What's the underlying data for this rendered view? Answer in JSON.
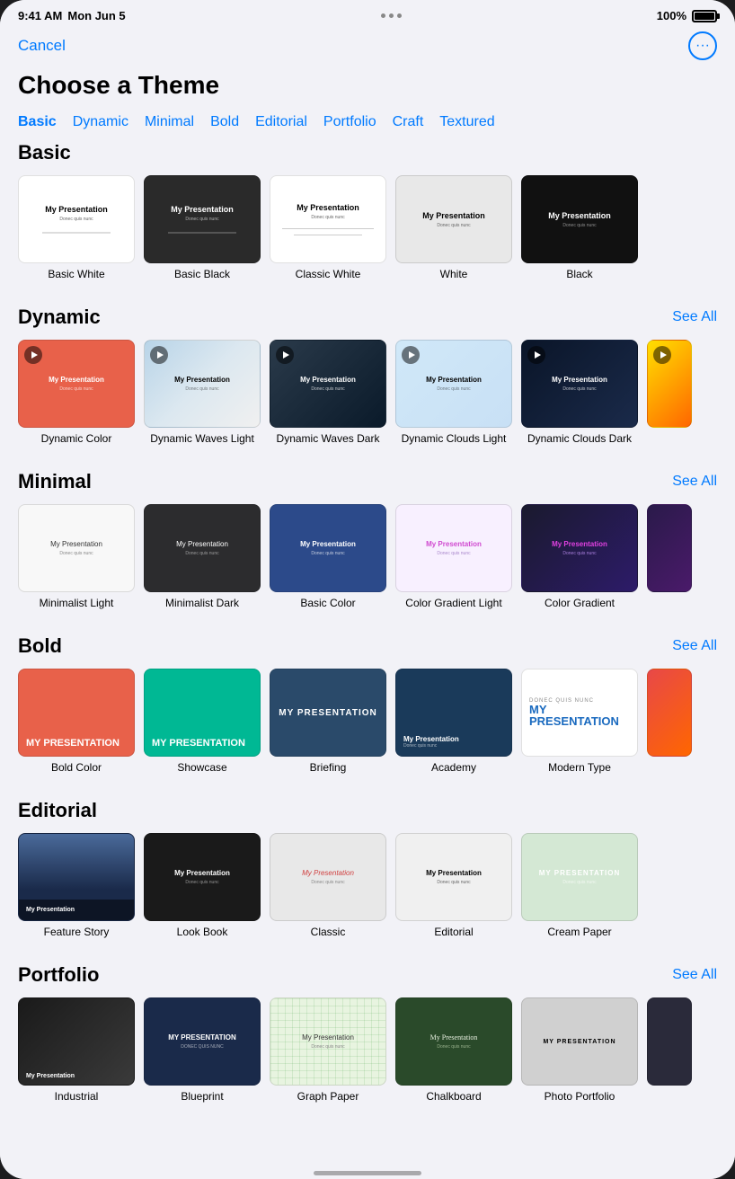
{
  "status": {
    "time": "9:41 AM",
    "day": "Mon Jun 5",
    "battery": "100%"
  },
  "nav": {
    "cancel": "Cancel",
    "title": "Choose a Theme"
  },
  "tabs": [
    {
      "id": "basic",
      "label": "Basic",
      "active": true
    },
    {
      "id": "dynamic",
      "label": "Dynamic",
      "active": false
    },
    {
      "id": "minimal",
      "label": "Minimal",
      "active": false
    },
    {
      "id": "bold",
      "label": "Bold",
      "active": false
    },
    {
      "id": "editorial",
      "label": "Editorial",
      "active": false
    },
    {
      "id": "portfolio",
      "label": "Portfolio",
      "active": false
    },
    {
      "id": "craft",
      "label": "Craft",
      "active": false
    },
    {
      "id": "textured",
      "label": "Textured",
      "active": false
    }
  ],
  "sections": {
    "basic": {
      "title": "Basic",
      "seeAll": null,
      "themes": [
        {
          "id": "basic-white",
          "name": "Basic White"
        },
        {
          "id": "basic-black",
          "name": "Basic Black"
        },
        {
          "id": "classic-white",
          "name": "Classic White"
        },
        {
          "id": "white",
          "name": "White"
        },
        {
          "id": "black",
          "name": "Black"
        }
      ]
    },
    "dynamic": {
      "title": "Dynamic",
      "seeAll": "See All",
      "themes": [
        {
          "id": "dynamic-color",
          "name": "Dynamic Color"
        },
        {
          "id": "dynamic-waves-light",
          "name": "Dynamic Waves Light"
        },
        {
          "id": "dynamic-waves-dark",
          "name": "Dynamic Waves Dark"
        },
        {
          "id": "dynamic-clouds-light",
          "name": "Dynamic Clouds Light"
        },
        {
          "id": "dynamic-clouds-dark",
          "name": "Dynamic Clouds Dark"
        },
        {
          "id": "dynamic-partial",
          "name": "",
          "partial": true
        }
      ]
    },
    "minimal": {
      "title": "Minimal",
      "seeAll": "See All",
      "themes": [
        {
          "id": "minimalist-light",
          "name": "Minimalist Light"
        },
        {
          "id": "minimalist-dark",
          "name": "Minimalist Dark"
        },
        {
          "id": "basic-color",
          "name": "Basic Color"
        },
        {
          "id": "color-gradient-light",
          "name": "Color Gradient Light"
        },
        {
          "id": "color-gradient",
          "name": "Color Gradient"
        },
        {
          "id": "minimal-partial",
          "name": "",
          "partial": true
        }
      ]
    },
    "bold": {
      "title": "Bold",
      "seeAll": "See All",
      "themes": [
        {
          "id": "bold-color",
          "name": "Bold Color"
        },
        {
          "id": "showcase",
          "name": "Showcase"
        },
        {
          "id": "briefing",
          "name": "Briefing"
        },
        {
          "id": "academy",
          "name": "Academy"
        },
        {
          "id": "modern-type",
          "name": "Modern Type"
        },
        {
          "id": "bold-partial",
          "name": "",
          "partial": true
        }
      ]
    },
    "editorial": {
      "title": "Editorial",
      "seeAll": null,
      "themes": [
        {
          "id": "feature-story",
          "name": "Feature Story"
        },
        {
          "id": "look-book",
          "name": "Look Book"
        },
        {
          "id": "classic",
          "name": "Classic"
        },
        {
          "id": "editorial",
          "name": "Editorial"
        },
        {
          "id": "cream-paper",
          "name": "Cream Paper"
        }
      ]
    },
    "portfolio": {
      "title": "Portfolio",
      "seeAll": "See All",
      "themes": [
        {
          "id": "industrial",
          "name": "Industrial"
        },
        {
          "id": "blueprint",
          "name": "Blueprint"
        },
        {
          "id": "graph-paper",
          "name": "Graph Paper"
        },
        {
          "id": "chalkboard",
          "name": "Chalkboard"
        },
        {
          "id": "photo-portfolio",
          "name": "Photo Portfolio"
        },
        {
          "id": "portfolio-partial",
          "name": "",
          "partial": true
        }
      ]
    }
  }
}
